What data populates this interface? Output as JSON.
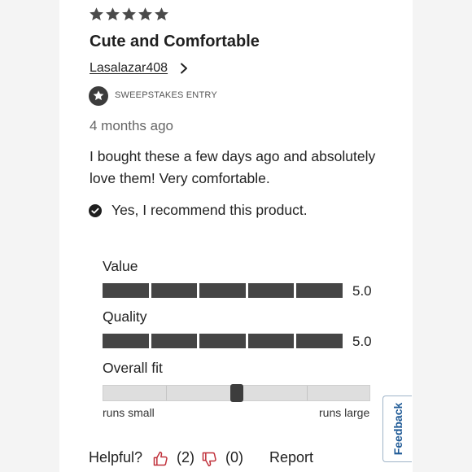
{
  "review": {
    "rating": 5,
    "title": "Cute and Comfortable",
    "author": "Lasalazar408",
    "badge": "SWEEPSTAKES ENTRY",
    "date": "4 months ago",
    "body": "I bought these a few days ago and absolutely love them! Very comfortable.",
    "recommend": "Yes, I recommend this product."
  },
  "ratings": [
    {
      "label": "Value",
      "value": "5.0",
      "score": 5
    },
    {
      "label": "Quality",
      "value": "5.0",
      "score": 5
    }
  ],
  "fit": {
    "label": "Overall fit",
    "position_fraction": 0.5,
    "low_label": "runs small",
    "high_label": "runs large"
  },
  "helpful": {
    "label": "Helpful?",
    "yes_count": "(2)",
    "no_count": "(0)",
    "report_label": "Report"
  },
  "feedback_tab": {
    "label": "Feedback"
  },
  "colors": {
    "bar_fill": "#454545",
    "thumb_icon": "#c0303a",
    "feedback_text": "#1f5a96",
    "feedback_border": "#9fb4c8"
  },
  "icons": {
    "stars": "star-icon",
    "badge": "star-badge-icon",
    "recommend": "check-circle-icon",
    "helpful_yes": "thumbs-up-icon",
    "helpful_no": "thumbs-down-icon",
    "author_link": "chevron-right-icon"
  }
}
